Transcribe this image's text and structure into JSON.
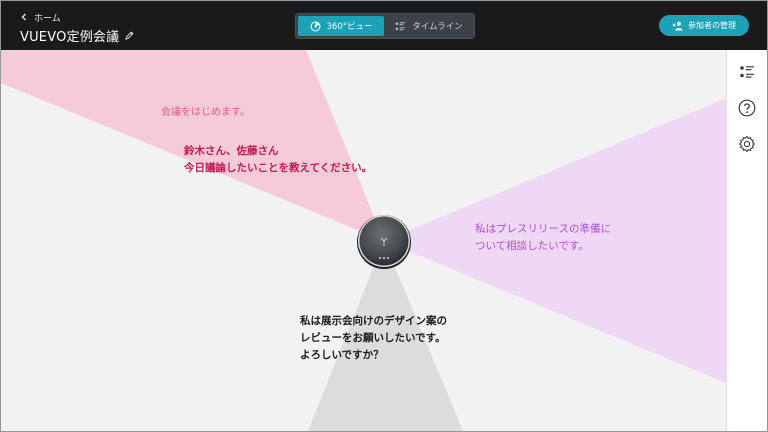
{
  "header": {
    "back_label": "ホーム",
    "title": "VUEVO定例会議",
    "tabs": [
      {
        "label": "360°ビュー",
        "active": true
      },
      {
        "label": "タイムライン",
        "active": false
      }
    ],
    "manage_button": "参加者の管理"
  },
  "stage": {
    "utterances": {
      "top_left_faded": "会議をはじめます。",
      "top_left_line1": "鈴木さん、佐藤さん",
      "top_left_line2": "今日議論したいことを教えてください。",
      "right_line1": "私はプレスリリースの準備に",
      "right_line2": "ついて相談したいです。",
      "bottom_line1": "私は展示会向けのデザイン案の",
      "bottom_line2": "レビューをお願いしたいです。",
      "bottom_line3": "よろしいですか？"
    }
  },
  "colors": {
    "header_bg": "#1a1a1a",
    "accent": "#1ba2b7",
    "beam_pink": "#f5cbd9",
    "beam_purple": "#eed8f5",
    "beam_gray": "#dcdcdc",
    "text_pink": "#c8194f",
    "text_purple": "#b04ed6"
  },
  "icons": {
    "back": "chevron-left-icon",
    "edit": "pencil-icon",
    "view360": "360-view-icon",
    "timeline": "timeline-list-icon",
    "add_user": "add-user-icon",
    "side_list": "list-icon",
    "side_help": "help-icon",
    "side_settings": "gear-icon"
  }
}
